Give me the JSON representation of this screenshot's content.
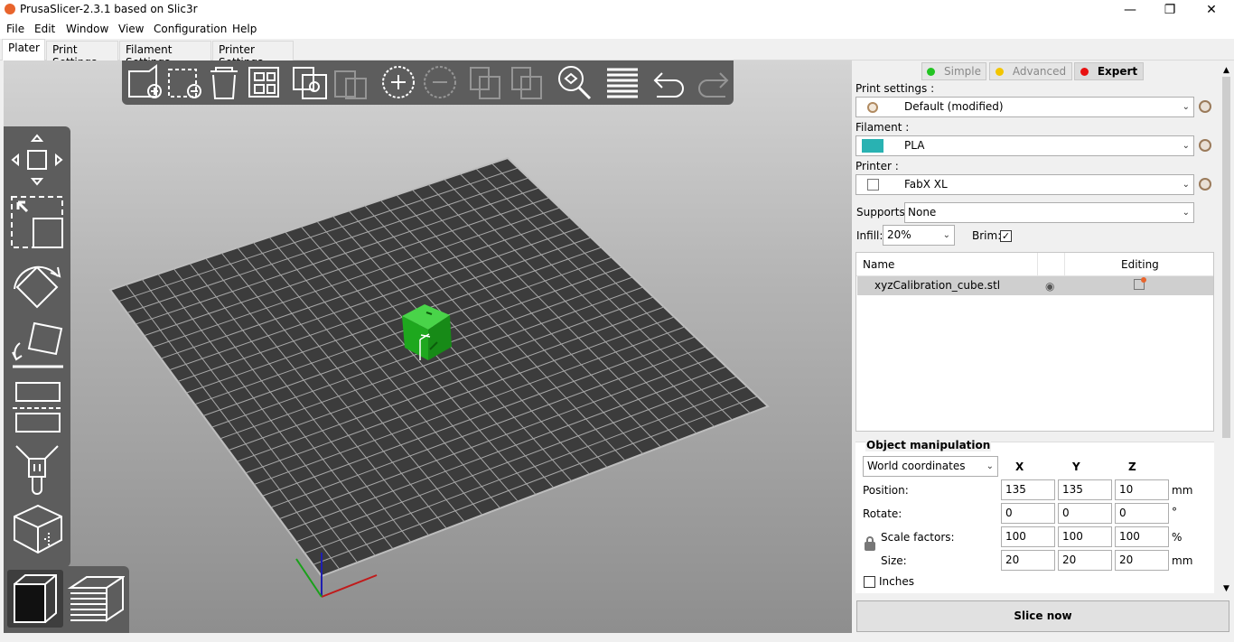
{
  "window": {
    "title": "PrusaSlicer-2.3.1 based on Slic3r"
  },
  "menu": [
    "File",
    "Edit",
    "Window",
    "View",
    "Configuration",
    "Help"
  ],
  "tabs": [
    "Plater",
    "Print Settings",
    "Filament Settings",
    "Printer Settings"
  ],
  "modes": {
    "simple": "Simple",
    "advanced": "Advanced",
    "expert": "Expert"
  },
  "colors": {
    "simple": "#22c422",
    "advanced": "#f2c500",
    "expert": "#e81010",
    "filament": "#29b2b2",
    "cube": "#22b522"
  },
  "print_settings": {
    "label": "Print settings :",
    "value": "Default (modified)"
  },
  "filament": {
    "label": "Filament :",
    "value": "PLA"
  },
  "printer": {
    "label": "Printer :",
    "value": "FabX XL"
  },
  "supports": {
    "label": "Supports:",
    "value": "None"
  },
  "infill": {
    "label": "Infill:",
    "value": "20%"
  },
  "brim": {
    "label": "Brim:",
    "checked": "✓"
  },
  "object_list": {
    "col_name": "Name",
    "col_editing": "Editing",
    "items": [
      {
        "name": "xyzCalibration_cube.stl"
      }
    ]
  },
  "manipulation": {
    "title": "Object manipulation",
    "coords": "World coordinates",
    "x": "X",
    "y": "Y",
    "z": "Z",
    "position": {
      "label": "Position:",
      "x": "135",
      "y": "135",
      "z": "10",
      "unit": "mm"
    },
    "rotate": {
      "label": "Rotate:",
      "x": "0",
      "y": "0",
      "z": "0",
      "unit": "°"
    },
    "scale": {
      "label": "Scale factors:",
      "x": "100",
      "y": "100",
      "z": "100",
      "unit": "%"
    },
    "size": {
      "label": "Size:",
      "x": "20",
      "y": "20",
      "z": "20",
      "unit": "mm"
    },
    "inches": "Inches"
  },
  "slice_button": "Slice now"
}
